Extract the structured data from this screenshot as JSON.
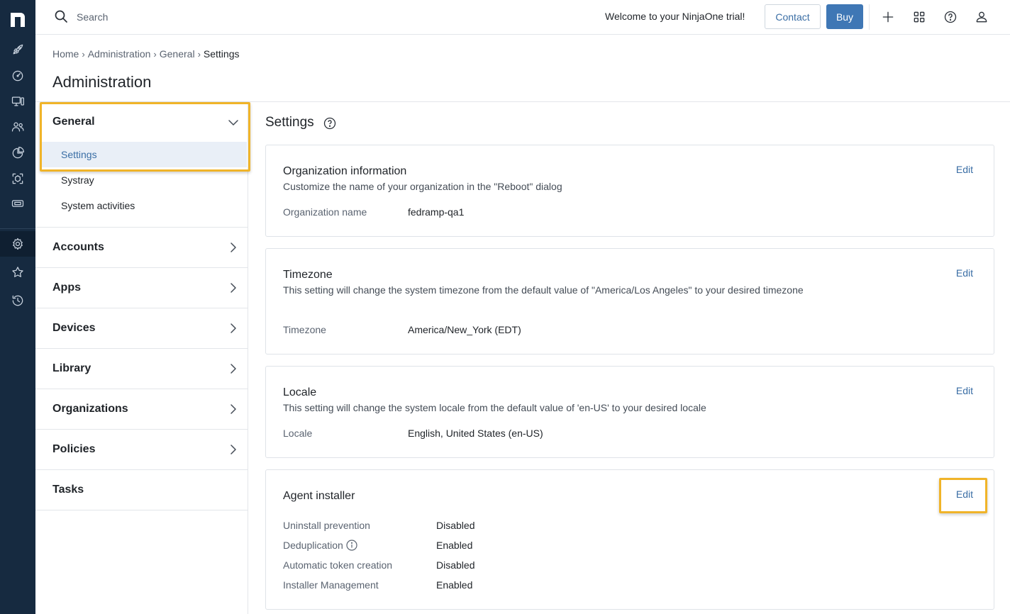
{
  "app": {
    "logo_letter": "n"
  },
  "topbar": {
    "search_placeholder": "Search",
    "welcome_text": "Welcome to your NinjaOne trial!",
    "contact_label": "Contact",
    "buy_label": "Buy",
    "icons": [
      "plus-icon",
      "apps-grid-icon",
      "help-icon",
      "user-icon"
    ]
  },
  "rail": {
    "icons": [
      "rocket-icon",
      "dashboard-icon",
      "devices-icon",
      "users-icon",
      "reports-icon",
      "security-icon",
      "ticketing-icon",
      "settings-icon",
      "favorites-icon",
      "history-icon"
    ],
    "active": "settings-icon"
  },
  "breadcrumb": [
    "Home",
    "Administration",
    "General",
    "Settings"
  ],
  "page_title": "Administration",
  "nav": {
    "general": {
      "label": "General",
      "items": [
        "Settings",
        "Systray",
        "System activities"
      ],
      "active_item": "Settings"
    },
    "groups": [
      "Accounts",
      "Apps",
      "Devices",
      "Library",
      "Organizations",
      "Policies",
      "Tasks"
    ]
  },
  "main": {
    "section_title": "Settings",
    "cards": {
      "org": {
        "title": "Organization information",
        "desc": "Customize the name of your organization in the \"Reboot\" dialog",
        "field_label": "Organization name",
        "field_value": "fedramp-qa1",
        "edit": "Edit"
      },
      "tz": {
        "title": "Timezone",
        "desc": "This setting will change the system timezone from the default value of \"America/Los Angeles\" to your desired timezone",
        "field_label": "Timezone",
        "field_value": "America/New_York (EDT)",
        "edit": "Edit"
      },
      "locale": {
        "title": "Locale",
        "desc": "This setting will change the system locale from the default value of 'en-US' to your desired locale",
        "field_label": "Locale",
        "field_value": "English, United States (en-US)",
        "edit": "Edit"
      },
      "agent": {
        "title": "Agent installer",
        "edit": "Edit",
        "rows": [
          {
            "label": "Uninstall prevention",
            "value": "Disabled"
          },
          {
            "label": "Deduplication",
            "value": "Enabled"
          },
          {
            "label": "Automatic token creation",
            "value": "Disabled"
          },
          {
            "label": "Installer Management",
            "value": "Enabled"
          }
        ]
      }
    }
  },
  "colors": {
    "rail_bg": "#162a40",
    "accent": "#3f77b5",
    "link": "#3a6ea5",
    "highlight": "#f0b429",
    "active_nav_bg": "#e9eff7"
  }
}
